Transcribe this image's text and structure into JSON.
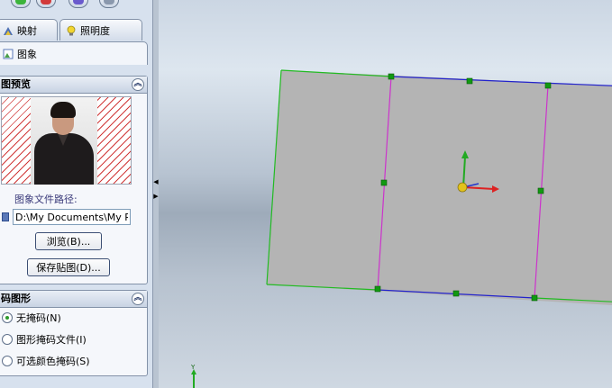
{
  "toolbar": {
    "ok_icon": "check-icon",
    "cancel_icon": "close-icon",
    "help_icon": "help-icon",
    "pin_icon": "pushpin-icon",
    "colors": [
      "#3bb43b",
      "#d23a3a",
      "#6a5acd",
      "#8a98ad"
    ]
  },
  "tabs": [
    {
      "label": "映射",
      "icon": "mapping-icon"
    },
    {
      "label": "照明度",
      "icon": "lightbulb-icon"
    },
    {
      "label": "图象",
      "icon": "image-icon"
    }
  ],
  "preview_section": {
    "title": "图预览",
    "path_label": "图象文件路径:",
    "path_value": "D:\\My Documents\\My Pictu",
    "browse_label": "浏览(B)...",
    "save_label": "保存贴图(D)..."
  },
  "mask_section": {
    "title": "码图形",
    "options": [
      {
        "label": "无掩码(N)",
        "checked": true
      },
      {
        "label": "图形掩码文件(I)",
        "checked": false
      },
      {
        "label": "可选颜色掩码(S)",
        "checked": false
      }
    ]
  },
  "viewport": {
    "triad_label": "Y",
    "colors": {
      "face": "#b4b4b4",
      "edge_green": "#22bb22",
      "edge_blue": "#2222cc",
      "edge_magenta": "#cc33cc",
      "handle": "#119911"
    }
  }
}
